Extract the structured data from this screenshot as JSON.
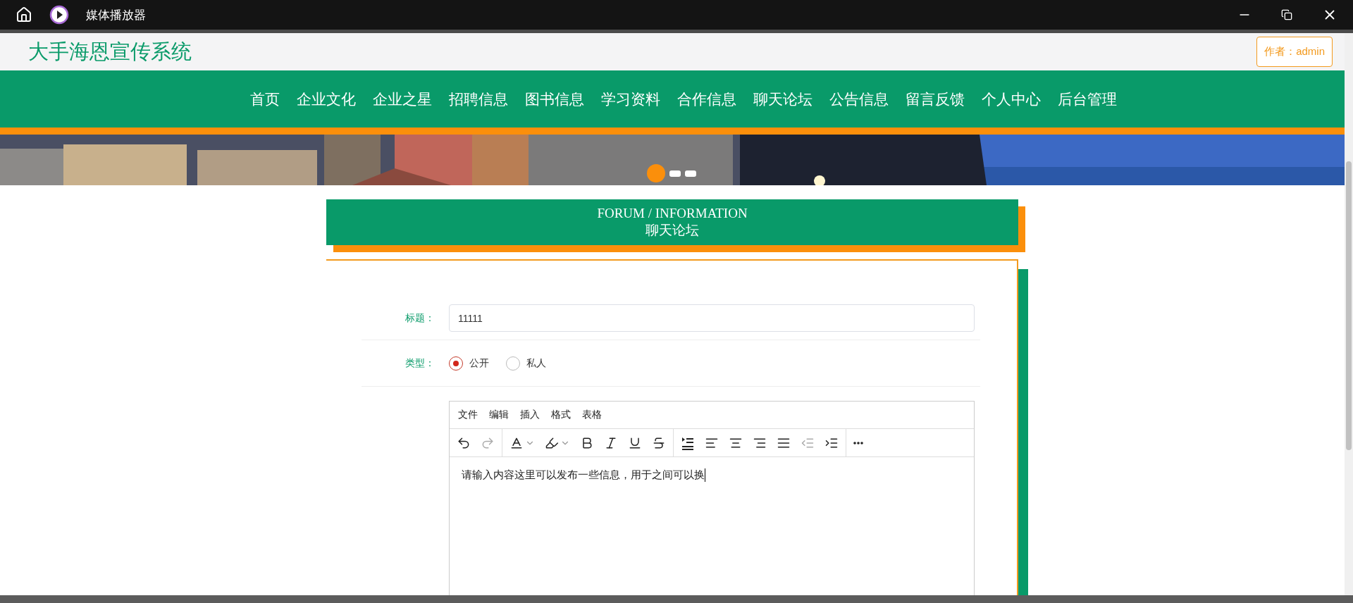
{
  "titlebar": {
    "title": "媒体播放器"
  },
  "header": {
    "site_title": "大手海恩宣传系统",
    "author_badge": "作者：admin"
  },
  "nav": [
    "首页",
    "企业文化",
    "企业之星",
    "招聘信息",
    "图书信息",
    "学习资料",
    "合作信息",
    "聊天论坛",
    "公告信息",
    "留言反馈",
    "个人中心",
    "后台管理"
  ],
  "banner": {
    "kind": "picture",
    "slides": [
      {
        "selected": true
      },
      {
        "selected": false
      },
      {
        "selected": false
      }
    ]
  },
  "section": {
    "title_en": "FORUM / INFORMATION",
    "title_zh": "聊天论坛"
  },
  "form": {
    "fields": [
      {
        "kind": "text",
        "label": "标题：",
        "value": "11111"
      },
      {
        "kind": "radio",
        "label": "类型：",
        "options": [
          {
            "label": "公开",
            "selected": true
          },
          {
            "label": "私人",
            "selected": false
          }
        ]
      }
    ],
    "editor": {
      "menu": [
        "文件",
        "编辑",
        "插入",
        "格式",
        "表格"
      ],
      "toolbar": [
        [
          {
            "kind": "undo",
            "disabled": false
          },
          {
            "kind": "redo",
            "disabled": true
          }
        ],
        [
          {
            "kind": "font-color",
            "disabled": false
          },
          {
            "kind": "highlight",
            "disabled": false
          },
          {
            "kind": "bold",
            "disabled": false
          },
          {
            "kind": "italic",
            "disabled": false
          },
          {
            "kind": "underline",
            "disabled": false
          },
          {
            "kind": "strike",
            "disabled": false
          }
        ],
        [
          {
            "kind": "line-height",
            "disabled": false
          },
          {
            "kind": "align-left",
            "disabled": false
          },
          {
            "kind": "align-center",
            "disabled": false
          },
          {
            "kind": "align-right",
            "disabled": false
          },
          {
            "kind": "justify",
            "disabled": false
          },
          {
            "kind": "outdent",
            "disabled": true
          },
          {
            "kind": "indent",
            "disabled": false
          }
        ],
        [
          {
            "kind": "more",
            "disabled": false
          }
        ]
      ],
      "content": "请输入内容这里可以发布一些信息，用于之间可以换"
    }
  }
}
